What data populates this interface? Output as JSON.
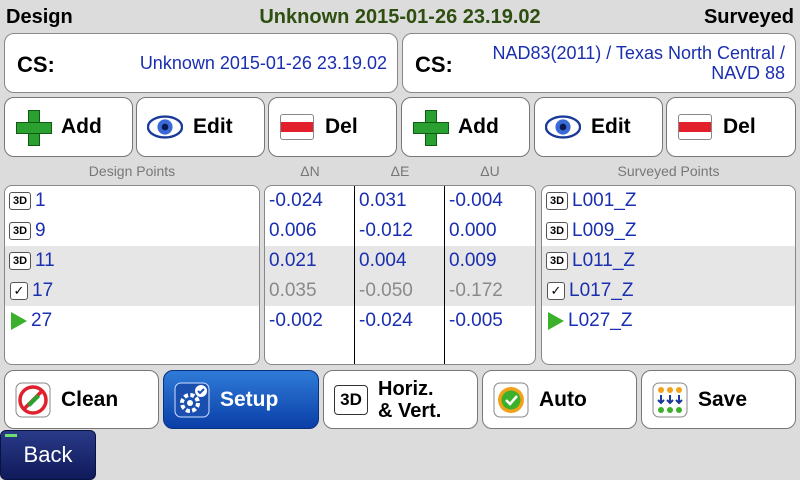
{
  "header": {
    "left": "Design",
    "center": "Unknown 2015-01-26 23.19.02",
    "right": "Surveyed"
  },
  "cs_left": {
    "label": "CS:",
    "value": "Unknown 2015-01-26 23.19.02"
  },
  "cs_right": {
    "label": "CS:",
    "value": "NAD83(2011) / Texas North Central / NAVD 88"
  },
  "left_buttons": {
    "add": "Add",
    "edit": "Edit",
    "del": "Del"
  },
  "right_buttons": {
    "add": "Add",
    "edit": "Edit",
    "del": "Del"
  },
  "columns": {
    "design": "Design Points",
    "dn": "ΔN",
    "de": "ΔE",
    "du": "ΔU",
    "surveyed": "Surveyed Points"
  },
  "design_points": [
    {
      "icon": "3d-icon",
      "badge": "3D",
      "name": "1"
    },
    {
      "icon": "3d-icon",
      "badge": "3D",
      "name": "9"
    },
    {
      "icon": "3d-icon",
      "badge": "3D",
      "name": "11"
    },
    {
      "icon": "check-icon",
      "badge": "✓",
      "name": "17"
    },
    {
      "icon": "play-icon",
      "badge": "",
      "name": "27"
    }
  ],
  "deltas": [
    {
      "dn": "-0.024",
      "de": "0.031",
      "du": "-0.004",
      "color": "#1a2fb0"
    },
    {
      "dn": "0.006",
      "de": "-0.012",
      "du": "0.000",
      "color": "#1a2fb0"
    },
    {
      "dn": "0.021",
      "de": "0.004",
      "du": "0.009",
      "color": "#1a2fb0"
    },
    {
      "dn": "0.035",
      "de": "-0.050",
      "du": "-0.172",
      "color": "#8a8a8a"
    },
    {
      "dn": "-0.002",
      "de": "-0.024",
      "du": "-0.005",
      "color": "#1a2fb0"
    }
  ],
  "surveyed_points": [
    {
      "icon": "3d-icon",
      "badge": "3D",
      "name": "L001_Z"
    },
    {
      "icon": "3d-icon",
      "badge": "3D",
      "name": "L009_Z"
    },
    {
      "icon": "3d-icon",
      "badge": "3D",
      "name": "L011_Z"
    },
    {
      "icon": "check-icon",
      "badge": "✓",
      "name": "L017_Z"
    },
    {
      "icon": "play-icon",
      "badge": "",
      "name": "L027_Z"
    }
  ],
  "bottom": {
    "clean": "Clean",
    "setup": "Setup",
    "hv_line1": "Horiz.",
    "hv_line2": "& Vert.",
    "hv_badge": "3D",
    "auto": "Auto",
    "save": "Save"
  },
  "back": "Back",
  "colors": {
    "accent": "#1a2fb0",
    "title_green": "#2e4f10",
    "active_button": "#1f5fc8"
  }
}
